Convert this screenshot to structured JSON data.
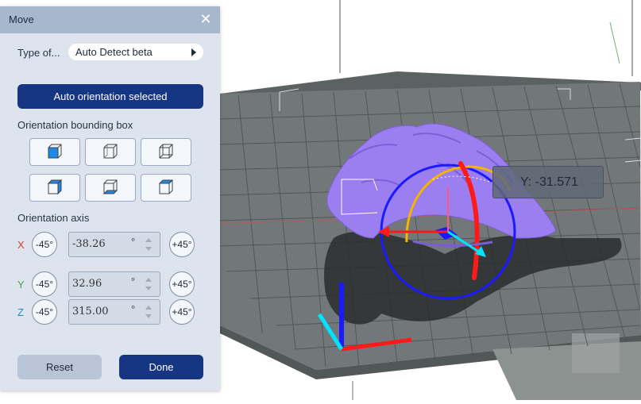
{
  "panel": {
    "title": "Move",
    "type_label": "Type of...",
    "type_value": "Auto Detect beta",
    "auto_button": "Auto orientation selected",
    "bbox_label": "Orientation bounding box",
    "axis_label": "Orientation axis",
    "axes": [
      {
        "name": "X",
        "value": "-38.26",
        "color": "#e53935"
      },
      {
        "name": "Y",
        "value": "32.96",
        "color": "#43a047"
      },
      {
        "name": "Z",
        "value": "315.00",
        "color": "#1e88e5"
      }
    ],
    "minus_label": "-45°",
    "plus_label": "+45°",
    "degree_symbol": "°",
    "reset_button": "Reset",
    "done_button": "Done"
  },
  "viewport": {
    "tooltip": "Y: -31.571",
    "colors": {
      "model": "#9b7ef0",
      "bed": "#6f7573",
      "x_axis": "#ff1a1a",
      "y_axis": "#00e5ff",
      "z_axis": "#1a1aff",
      "ring_y": "#f4b400"
    }
  }
}
